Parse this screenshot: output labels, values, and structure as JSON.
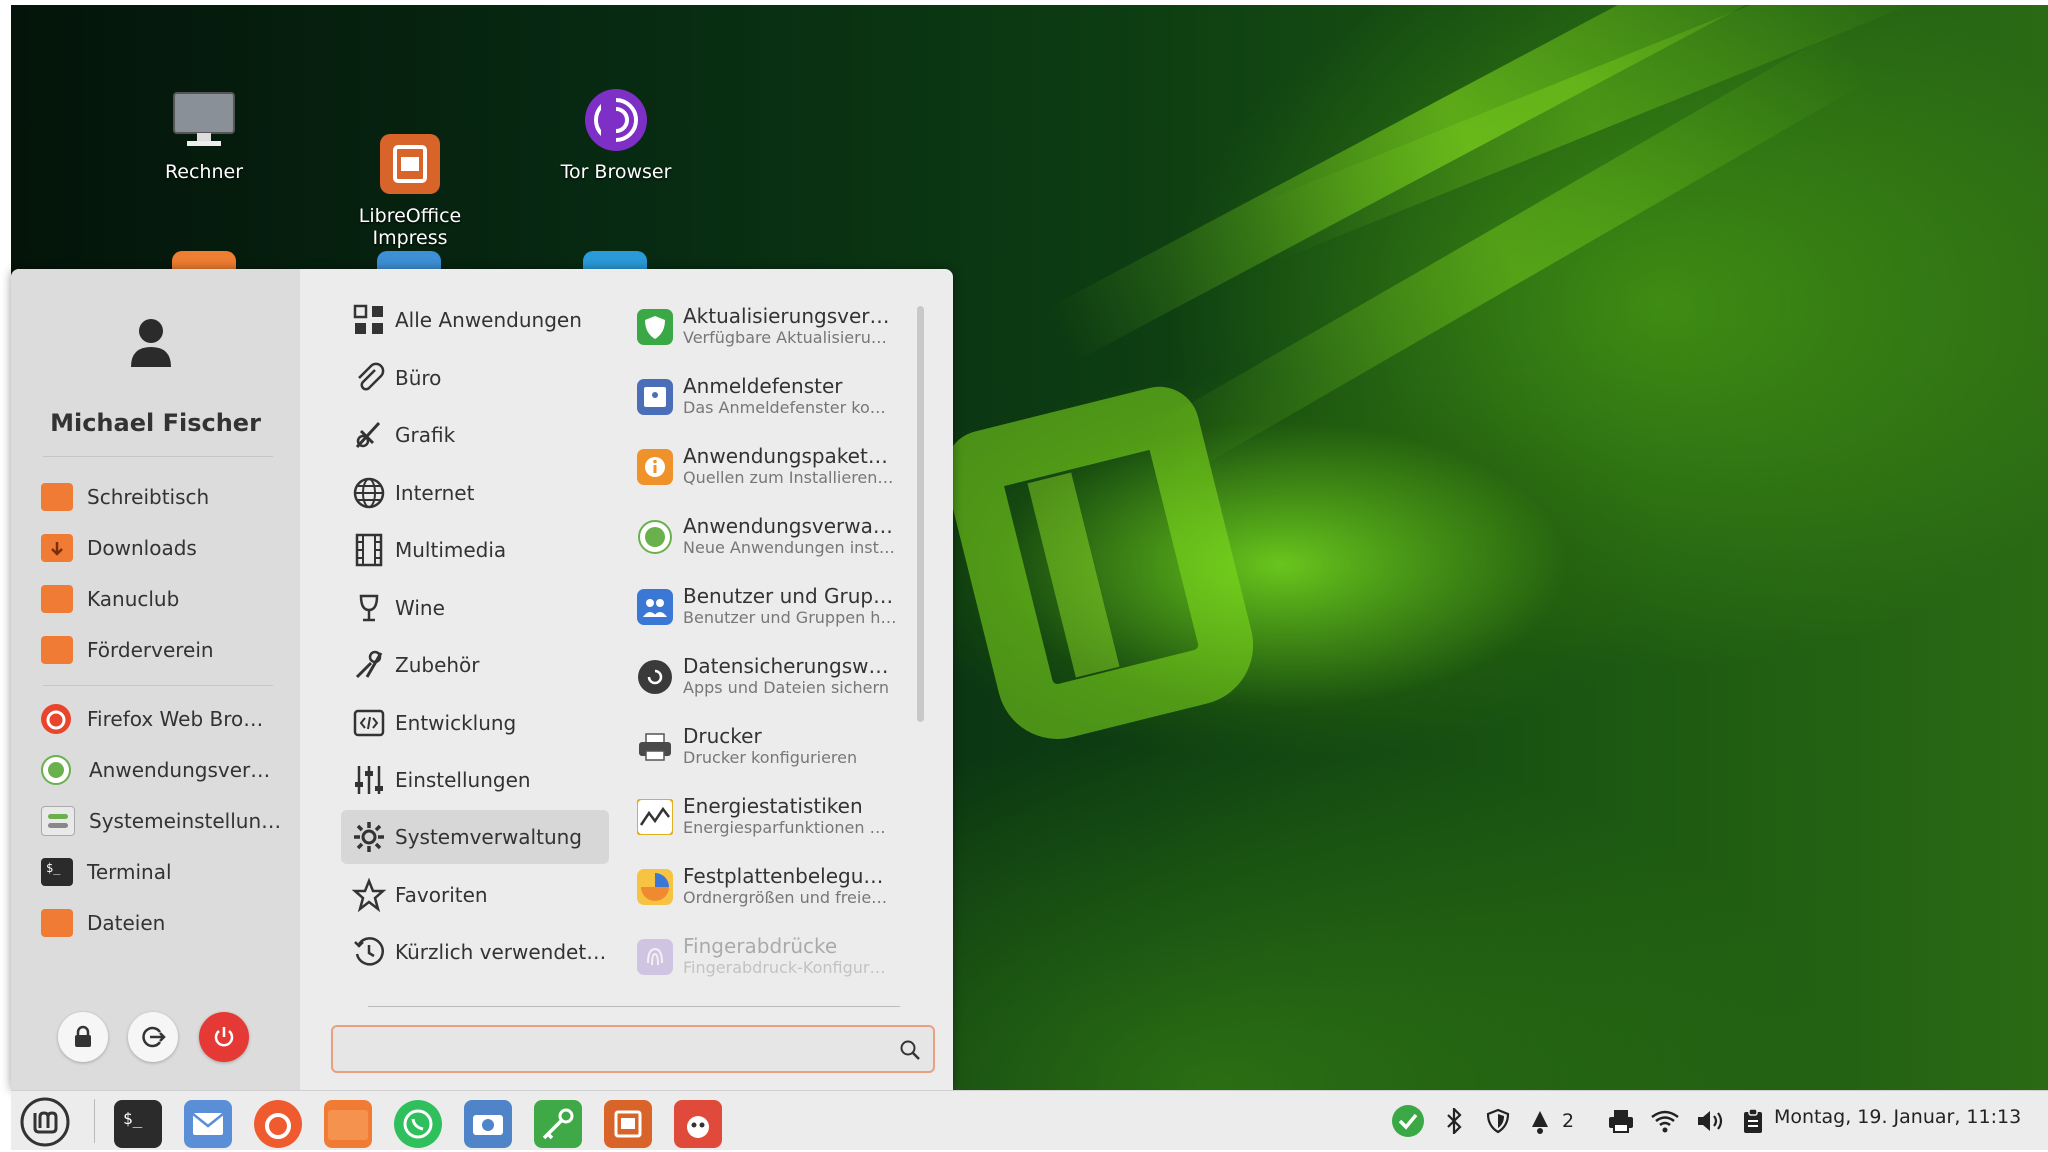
{
  "desktop": {
    "icons": [
      {
        "label": "Rechner"
      },
      {
        "label": "LibreOffice\nImpress"
      },
      {
        "label": "Tor Browser"
      }
    ]
  },
  "menu": {
    "user": {
      "name": "Michael Fischer"
    },
    "places": [
      {
        "label": "Schreibtisch",
        "icon": "folder-desktop-icon"
      },
      {
        "label": "Downloads",
        "icon": "folder-downloads-icon"
      },
      {
        "label": "Kanuclub",
        "icon": "folder-icon"
      },
      {
        "label": "Förderverein",
        "icon": "folder-icon"
      }
    ],
    "favorites": [
      {
        "label": "Firefox Web Bro…",
        "icon": "firefox-icon"
      },
      {
        "label": "Anwendungsver…",
        "icon": "software-manager-icon"
      },
      {
        "label": "Systemeinstellun…",
        "icon": "settings-icon"
      },
      {
        "label": "Terminal",
        "icon": "terminal-icon"
      },
      {
        "label": "Dateien",
        "icon": "files-icon"
      }
    ],
    "categories": [
      {
        "label": "Alle Anwendungen",
        "icon": "grid-icon"
      },
      {
        "label": "Büro",
        "icon": "paperclip-icon"
      },
      {
        "label": "Grafik",
        "icon": "palette-icon"
      },
      {
        "label": "Internet",
        "icon": "globe-icon"
      },
      {
        "label": "Multimedia",
        "icon": "film-icon"
      },
      {
        "label": "Wine",
        "icon": "wine-icon"
      },
      {
        "label": "Zubehör",
        "icon": "tools-icon"
      },
      {
        "label": "Entwicklung",
        "icon": "code-icon"
      },
      {
        "label": "Einstellungen",
        "icon": "sliders-icon"
      },
      {
        "label": "Systemverwaltung",
        "icon": "gear-icon",
        "active": true
      },
      {
        "label": "Favoriten",
        "icon": "star-icon"
      },
      {
        "label": "Kürzlich verwendet…",
        "icon": "history-icon"
      }
    ],
    "apps": [
      {
        "title": "Aktualisierungsver…",
        "desc": "Verfügbare Aktualisieru…",
        "color": "#3aa845"
      },
      {
        "title": "Anmeldefenster",
        "desc": "Das Anmeldefenster ko…",
        "color": "#4a6fb8"
      },
      {
        "title": "Anwendungspaket…",
        "desc": "Quellen zum Installieren…",
        "color": "#f0922a"
      },
      {
        "title": "Anwendungsverwa…",
        "desc": "Neue Anwendungen inst…",
        "color": "#6ab04c"
      },
      {
        "title": "Benutzer und Grup…",
        "desc": "Benutzer und Gruppen h…",
        "color": "#3b78d6"
      },
      {
        "title": "Datensicherungsw…",
        "desc": "Apps und Dateien sichern",
        "color": "#3a3a3a"
      },
      {
        "title": "Drucker",
        "desc": "Drucker konfigurieren",
        "color": "#4a4a4a"
      },
      {
        "title": "Energiestatistiken",
        "desc": "Energiesparfunktionen …",
        "color": "#f3c020"
      },
      {
        "title": "Festplattenbelegu…",
        "desc": "Ordnergrößen und freie…",
        "color": "#f08a30"
      },
      {
        "title": "Fingerabdrücke",
        "desc": "Fingerabdruck-Konfigur…",
        "color": "#9b7fd4"
      }
    ],
    "search": {
      "value": "",
      "placeholder": ""
    }
  },
  "taskbar": {
    "tray": {
      "notifications_count": "2"
    },
    "clock": "Montag, 19. Januar, 11:13"
  }
}
